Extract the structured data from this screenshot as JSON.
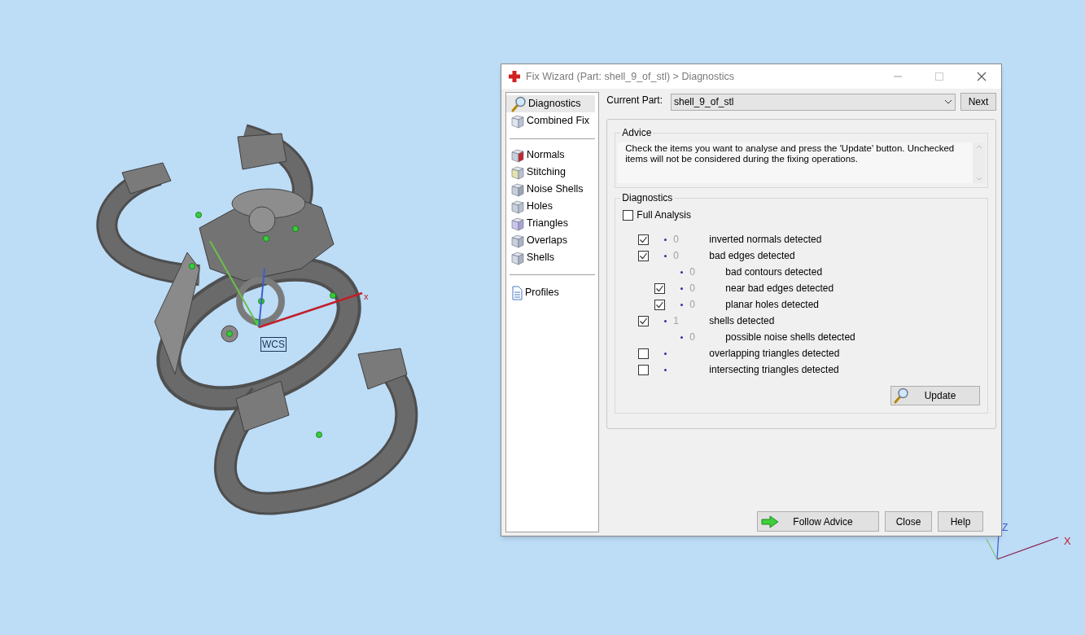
{
  "viewport": {
    "wcs_label": "WCS",
    "main_axis_label": "x",
    "corner_axes": {
      "x_label": "X",
      "z_label": "Z"
    }
  },
  "dialog": {
    "title": "Fix Wizard (Part: shell_9_of_stl) > Diagnostics",
    "nav_groups": [
      [
        {
          "label": "Diagnostics",
          "selected": true
        },
        {
          "label": "Combined Fix",
          "selected": false
        }
      ],
      [
        {
          "label": "Normals",
          "selected": false
        },
        {
          "label": "Stitching",
          "selected": false
        },
        {
          "label": "Noise Shells",
          "selected": false
        },
        {
          "label": "Holes",
          "selected": false
        },
        {
          "label": "Triangles",
          "selected": false
        },
        {
          "label": "Overlaps",
          "selected": false
        },
        {
          "label": "Shells",
          "selected": false
        }
      ],
      [
        {
          "label": "Profiles",
          "selected": false
        }
      ]
    ],
    "current_part": {
      "label": "Current Part:",
      "value": "shell_9_of_stl"
    },
    "next_button": "Next",
    "advice": {
      "title": "Advice",
      "text": "Check the items you want to analyse and press the 'Update' button. Unchecked items will not be considered during the fixing operations."
    },
    "diagnostics": {
      "title": "Diagnostics",
      "full_analysis": {
        "label": "Full Analysis",
        "checked": false
      },
      "items": [
        {
          "kind": "checkbox",
          "checked": true,
          "count": "0",
          "label": "inverted normals detected"
        },
        {
          "kind": "checkbox",
          "checked": true,
          "count": "0",
          "label": "bad edges detected",
          "children": [
            {
              "kind": "info",
              "count": "0",
              "label": "bad contours detected"
            },
            {
              "kind": "checkbox",
              "checked": true,
              "count": "0",
              "label": "near bad edges detected"
            },
            {
              "kind": "checkbox",
              "checked": true,
              "count": "0",
              "label": "planar holes detected"
            }
          ]
        },
        {
          "kind": "checkbox",
          "checked": true,
          "count": "1",
          "label": "shells detected",
          "children": [
            {
              "kind": "info",
              "count": "0",
              "label": "possible noise shells detected"
            }
          ]
        },
        {
          "kind": "checkbox",
          "checked": false,
          "label": "overlapping triangles detected"
        },
        {
          "kind": "checkbox",
          "checked": false,
          "label": "intersecting triangles detected"
        }
      ],
      "update_button": "Update"
    },
    "buttons": {
      "follow_advice": "Follow Advice",
      "close": "Close",
      "help": "Help"
    }
  }
}
